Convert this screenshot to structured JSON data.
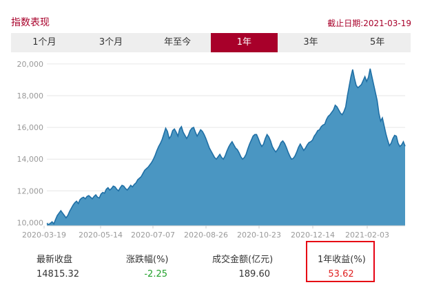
{
  "header": {
    "title": "指数表现",
    "as_of": "截止日期:2021-03-19"
  },
  "tabs": [
    {
      "label": "1个月",
      "active": false
    },
    {
      "label": "3个月",
      "active": false
    },
    {
      "label": "年至今",
      "active": false
    },
    {
      "label": "1年",
      "active": true
    },
    {
      "label": "3年",
      "active": false
    },
    {
      "label": "5年",
      "active": false
    }
  ],
  "stats": {
    "latest_close": {
      "label": "最新收盘",
      "value": "14815.32"
    },
    "change_pct": {
      "label": "涨跌幅(%)",
      "value": "-2.25"
    },
    "turnover": {
      "label": "成交金额(亿元)",
      "value": "189.60"
    },
    "one_year_return": {
      "label": "1年收益(%)",
      "value": "53.62"
    }
  },
  "colors": {
    "accent": "#a8002a",
    "area_fill": "#4a96c2",
    "area_line": "#1f6fa5",
    "negative": "#21a12b",
    "positive": "#e02020",
    "highlight_box": "#e60012"
  },
  "chart_data": {
    "type": "area",
    "title": "",
    "xlabel": "",
    "ylabel": "",
    "ylim": [
      9800,
      20300
    ],
    "y_ticks": [
      10000,
      12000,
      14000,
      16000,
      18000,
      20000
    ],
    "y_tick_labels": [
      "10,000",
      "12,000",
      "14,000",
      "16,000",
      "18,000",
      "20,000"
    ],
    "x_ticks": [
      "2020-03-19",
      "2020-05-14",
      "2020-07-07",
      "2020-08-26",
      "2020-10-23",
      "2020-12-14",
      "2021-02-03"
    ],
    "grid": "horizontal",
    "legend": "none",
    "series": [
      {
        "values": [
          9950,
          9880,
          9950,
          10050,
          9920,
          10200,
          10450,
          10600,
          10750,
          10600,
          10450,
          10300,
          10450,
          10700,
          10900,
          11100,
          11250,
          11350,
          11200,
          11450,
          11550,
          11600,
          11500,
          11650,
          11700,
          11600,
          11500,
          11650,
          11750,
          11600,
          11550,
          11800,
          11900,
          11850,
          12100,
          12200,
          12050,
          12150,
          12300,
          12250,
          12100,
          12000,
          12200,
          12350,
          12300,
          12150,
          12050,
          12200,
          12350,
          12250,
          12400,
          12500,
          12700,
          12800,
          12900,
          13100,
          13300,
          13400,
          13500,
          13650,
          13800,
          14000,
          14250,
          14550,
          14800,
          15000,
          15250,
          15600,
          15950,
          15750,
          15300,
          15450,
          15800,
          15900,
          15700,
          15450,
          15900,
          16050,
          15700,
          15500,
          15300,
          15500,
          15800,
          15950,
          16000,
          15700,
          15450,
          15650,
          15850,
          15750,
          15550,
          15300,
          15000,
          14700,
          14500,
          14300,
          14100,
          14000,
          14150,
          14300,
          14100,
          14000,
          14200,
          14500,
          14750,
          14950,
          15100,
          14900,
          14700,
          14600,
          14400,
          14150,
          14000,
          14100,
          14300,
          14650,
          14950,
          15200,
          15450,
          15550,
          15550,
          15300,
          15000,
          14800,
          14950,
          15300,
          15550,
          15400,
          15150,
          14800,
          14600,
          14450,
          14600,
          14800,
          15050,
          15150,
          15000,
          14750,
          14450,
          14200,
          14000,
          14050,
          14200,
          14450,
          14750,
          14950,
          14750,
          14550,
          14700,
          14900,
          15050,
          15100,
          15200,
          15450,
          15600,
          15800,
          15850,
          16050,
          16150,
          16200,
          16500,
          16700,
          16800,
          16950,
          17100,
          17400,
          17300,
          17100,
          16900,
          16800,
          17000,
          17300,
          18000,
          18600,
          19200,
          19650,
          19100,
          18650,
          18500,
          18600,
          18700,
          18950,
          19200,
          18900,
          19150,
          19700,
          19200,
          18700,
          18200,
          17700,
          16900,
          16400,
          16600,
          16100,
          15600,
          15200,
          14850,
          15000,
          15300,
          15500,
          15450,
          15000,
          14800,
          14900,
          15100,
          14815
        ]
      }
    ]
  }
}
